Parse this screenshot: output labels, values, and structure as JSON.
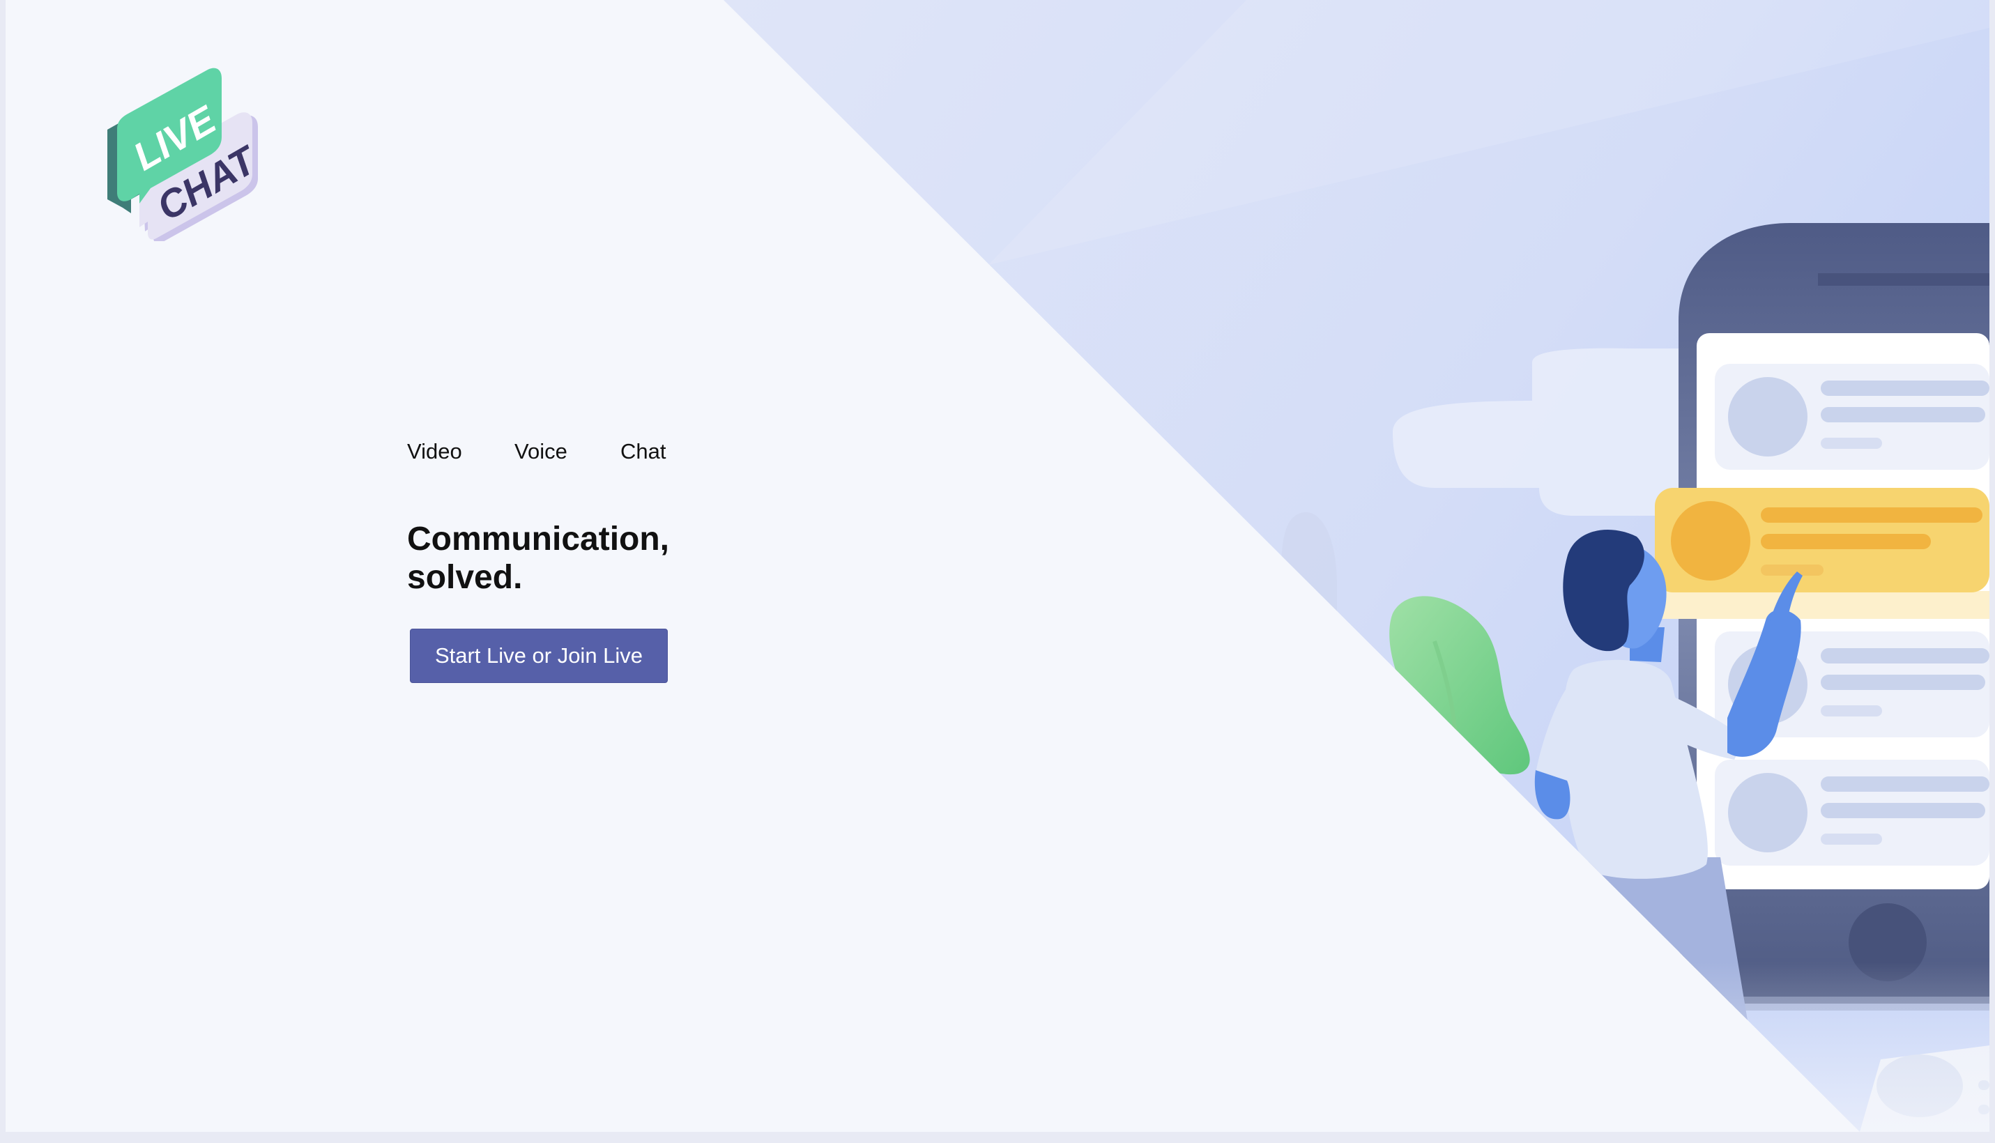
{
  "logo": {
    "line1": "LIVE",
    "line2": "CHAT"
  },
  "nav": {
    "items": [
      "Video",
      "Voice",
      "Chat"
    ]
  },
  "hero": {
    "headline_line1": "Communication,",
    "headline_line2": "solved.",
    "cta_label": "Start Live or Join Live"
  },
  "colors": {
    "page_bg": "#f5f7fc",
    "gradient_blue": "#c8d4f6",
    "cta_bg": "#5660a9",
    "logo_green": "#5fd3a6",
    "logo_lavender": "#e6e3f4",
    "phone_dark": "#5a6690",
    "highlight_yellow": "#f7d46f"
  },
  "icons": [
    "live-chat-logo-icon",
    "person-illustration-icon",
    "phone-illustration-icon",
    "plant-icon"
  ]
}
